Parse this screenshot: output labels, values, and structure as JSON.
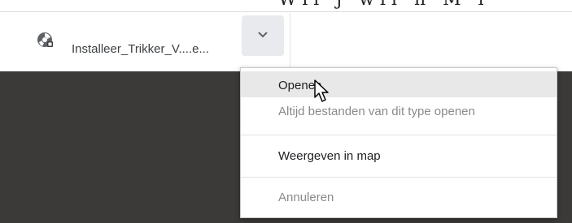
{
  "background_page": {
    "cutoff_text": "Wil j  wil   n    M     l"
  },
  "download_shelf": {
    "file_name": "Installeer_Trikker_V....e...",
    "file_icon": "disc-installer-icon",
    "menu_button_icon": "chevron-down-icon"
  },
  "context_menu": {
    "items": [
      {
        "label": "Openen",
        "enabled": true,
        "hovered": true
      },
      {
        "label": "Altijd bestanden van dit type openen",
        "enabled": false
      },
      {
        "label": "Weergeven in map",
        "enabled": true
      },
      {
        "label": "Annuleren",
        "enabled": false
      }
    ]
  },
  "colors": {
    "menu_hover": "#e8e8e8",
    "disabled_text": "#8a8a8a",
    "backdrop": "#3c3a38",
    "button_bg": "#e8eaed"
  }
}
